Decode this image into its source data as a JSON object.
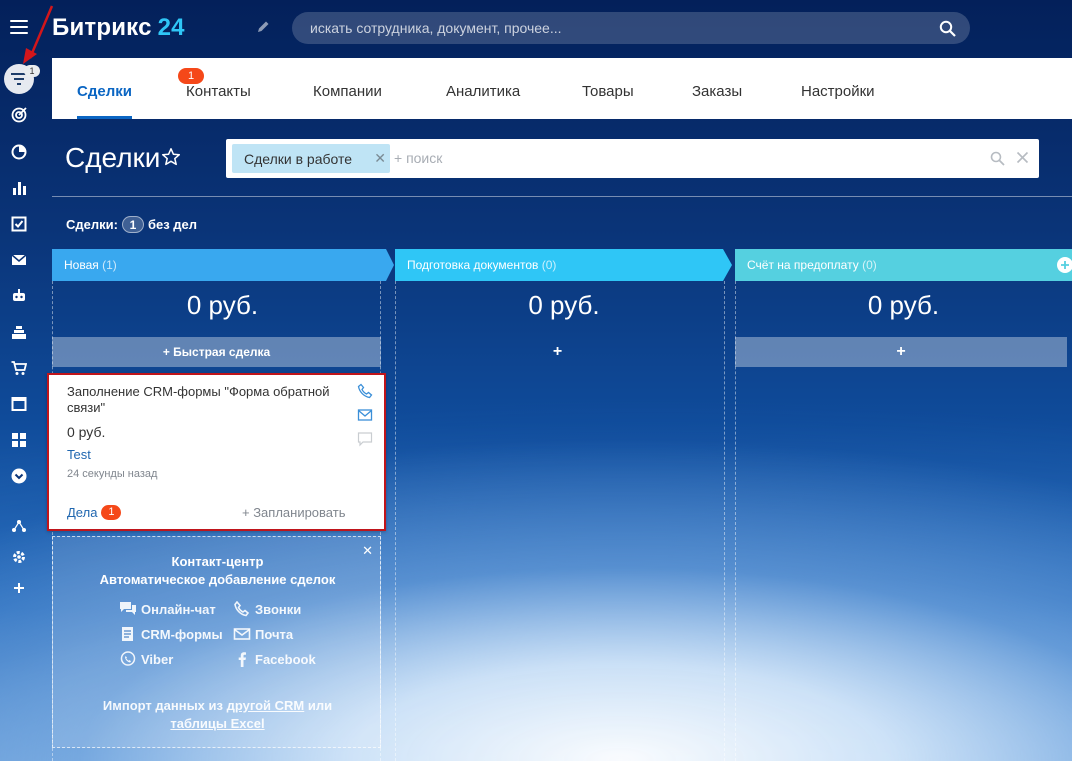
{
  "header": {
    "logo_name": "Битрикс",
    "logo_number": "24",
    "search_placeholder": "искать сотрудника, документ, прочее..."
  },
  "sidebar": {
    "filter_badge": "1",
    "icons": [
      "crm-filter-icon",
      "target-icon",
      "clock-icon",
      "analytics-icon",
      "tasks-icon",
      "mail-icon",
      "robot-icon",
      "sites-icon",
      "shop-icon",
      "window-icon",
      "apps-icon",
      "expand-icon",
      "network-icon",
      "settings-icon",
      "add-icon"
    ]
  },
  "tabs": {
    "items": [
      "Сделки",
      "Контакты",
      "Компании",
      "Аналитика",
      "Товары",
      "Заказы",
      "Настройки"
    ],
    "active_badge": "1"
  },
  "page": {
    "title": "Сделки",
    "filter_chip": "Сделки в работе",
    "filter_placeholder": "+ поиск"
  },
  "summary": {
    "label": "Сделки:",
    "count": "1",
    "suffix": "без дел"
  },
  "columns": [
    {
      "name": "Новая",
      "count": "(1)",
      "sum": "0 руб.",
      "button": "+ Быстрая сделка",
      "color": "#39a8ef"
    },
    {
      "name": "Подготовка документов",
      "count": "(0)",
      "sum": "0 руб.",
      "button": "+",
      "color": "#2fc6f6"
    },
    {
      "name": "Счёт на предоплату",
      "count": "(0)",
      "sum": "0 руб.",
      "button": "+",
      "color": "#55d0e0"
    }
  ],
  "deal_card": {
    "title": "Заполнение CRM-формы \"Форма обратной связи\"",
    "price": "0 руб.",
    "client": "Test",
    "time": "24 секунды назад",
    "activity_label": "Дела",
    "activity_badge": "1",
    "plan_label": "+ Запланировать"
  },
  "promo": {
    "title1": "Контакт-центр",
    "title2": "Автоматическое добавление сделок",
    "channels": [
      "Онлайн-чат",
      "Звонки",
      "CRM-формы",
      "Почта",
      "Viber",
      "Facebook"
    ],
    "import_prefix": "Импорт данных из",
    "import_link1": "другой CRM",
    "import_or": "или",
    "import_link2": "таблицы Excel"
  },
  "colors": {
    "accent": "#2fc6f6",
    "tab_active": "#0b66c3",
    "badge": "#f54819",
    "card_highlight": "#c0151b"
  }
}
